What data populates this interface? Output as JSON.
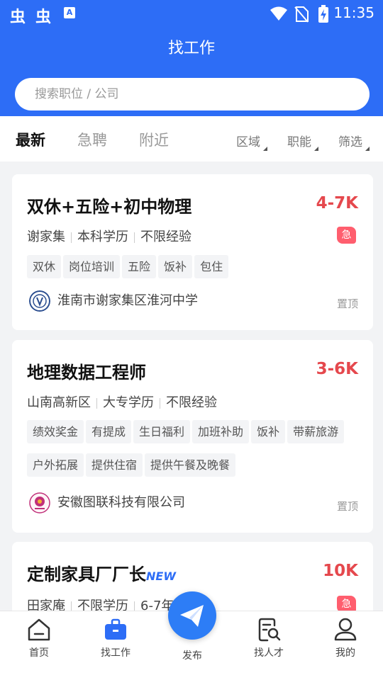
{
  "status_bar": {
    "time": "11:35",
    "a_icon": "A"
  },
  "header": {
    "title": "找工作",
    "search_placeholder": "搜索职位 / 公司"
  },
  "tabs": [
    "最新",
    "急聘",
    "附近"
  ],
  "filters": [
    "区域",
    "职能",
    "筛选"
  ],
  "jobs": [
    {
      "title": "双休+五险+初中物理",
      "salary": "4-7K",
      "location": "谢家集",
      "education": "本科学历",
      "experience": "不限经验",
      "urgent": "急",
      "tags": [
        "双休",
        "岗位培训",
        "五险",
        "饭补",
        "包住"
      ],
      "company": "淮南市谢家集区淮河中学",
      "pin": "置顶"
    },
    {
      "title": "地理数据工程师",
      "salary": "3-6K",
      "location": "山南高新区",
      "education": "大专学历",
      "experience": "不限经验",
      "tags": [
        "绩效奖金",
        "有提成",
        "生日福利",
        "加班补助",
        "饭补",
        "带薪旅游",
        "户外拓展",
        "提供住宿",
        "提供午餐及晚餐"
      ],
      "company": "安徽图联科技有限公司",
      "pin": "置顶"
    },
    {
      "title": "定制家具厂厂长",
      "new_badge": "NEW",
      "salary": "10K",
      "location": "田家庵",
      "education": "不限学历",
      "experience": "6-7年",
      "urgent": "急"
    }
  ],
  "bottom_nav": {
    "home": "首页",
    "jobs": "找工作",
    "post": "发布",
    "talent": "找人才",
    "mine": "我的"
  },
  "colors": {
    "primary": "#2d6df6",
    "salary": "#e5484d",
    "urgent": "#ff5e6e"
  }
}
